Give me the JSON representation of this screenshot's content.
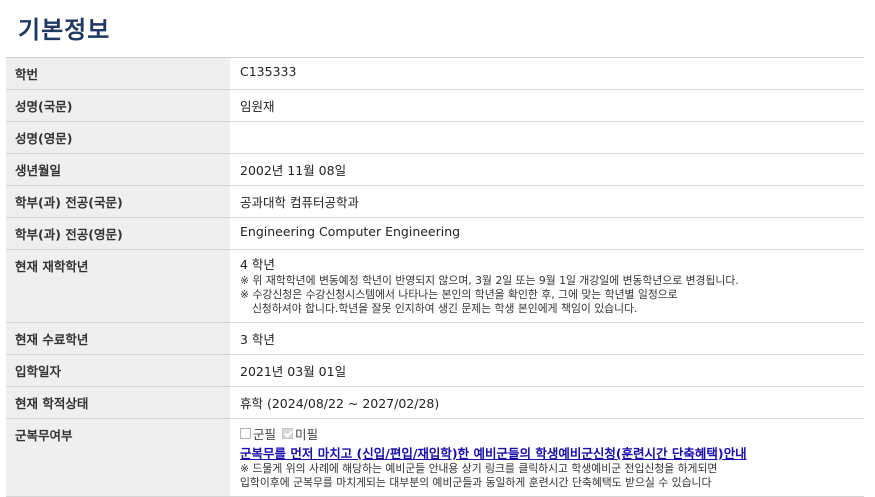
{
  "page_title": "기본정보",
  "rows": {
    "student_id": {
      "label": "학번",
      "value": "C135333"
    },
    "name_kr": {
      "label": "성명(국문)",
      "value": "임원재"
    },
    "name_en": {
      "label": "성명(영문)",
      "value": ""
    },
    "birth": {
      "label": "생년월일",
      "value": "2002년 11월 08일"
    },
    "dept_kr": {
      "label": "학부(과) 전공(국문)",
      "value": "공과대학 컴퓨터공학과"
    },
    "dept_en": {
      "label": "학부(과) 전공(영문)",
      "value": "Engineering Computer Engineering"
    },
    "grade": {
      "label": "현재 재학학년",
      "value": "4 학년",
      "note1": "※ 위 재학학년에 변동예정 학년이 반영되지 않으며, 3월 2일 또는 9월 1일 개강일에 변동학년으로 변경됩니다.",
      "note2": "※ 수강신청은 수강신청시스템에서 나타나는 본인의 학년을 확인한 후, 그에 맞는 학년별 일정으로",
      "note3": "신청하셔야 합니다.학년을 잘못 인지하여 생긴 문제는 학생 본인에게 책임이 있습니다."
    },
    "completed_grade": {
      "label": "현재 수료학년",
      "value": "3 학년"
    },
    "admission_date": {
      "label": "입학일자",
      "value": "2021년 03월 01일"
    },
    "status": {
      "label": "현재 학적상태",
      "value": "휴학 (2024/08/22 ~ 2027/02/28)"
    },
    "military": {
      "label": "군복무여부",
      "option_done": "군필",
      "option_not_done": "미필",
      "selected": "미필",
      "link_text": "군복무를 먼저 마치고 (신입/편입/재입학)한 예비군들의 학생예비군신청(훈련시간 단축혜택)안내",
      "note1": "※ 드물게 위의 사례에 해당하는 예비군들 안내용 상기 링크를 클릭하시고 학생예비군 전입신청을 하게되면",
      "note2": "입학이후에 군복무를 마치게되는 대부분의 예비군들과 동일하게 훈련시간 단축혜택도 받으실 수 있습니다"
    }
  }
}
